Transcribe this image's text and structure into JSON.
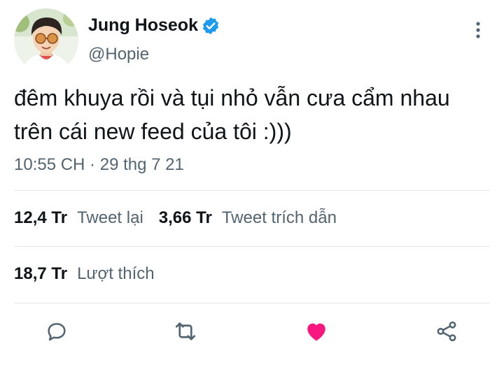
{
  "tweet": {
    "author_name": "Jung Hoseok",
    "handle": "@Hopie",
    "text_line1": "đêm khuya rồi và tụi nhỏ vẫn cưa cẩm nhau",
    "text_line2": "trên cái new feed của tôi :)))",
    "timestamp": "10:55 CH · 29 thg 7 21"
  },
  "stats": {
    "retweets_count": "12,4 Tr",
    "retweets_label": "Tweet lại",
    "quotes_count": "3,66 Tr",
    "quotes_label": "Tweet trích dẫn",
    "likes_count": "18,7 Tr",
    "likes_label": "Lượt thích"
  },
  "icons": {
    "verified": "verified-badge-icon",
    "more": "more-vertical-icon",
    "reply": "reply-icon",
    "retweet": "retweet-icon",
    "like": "heart-icon",
    "share": "share-icon"
  },
  "colors": {
    "verified_blue": "#1d9bf0",
    "like_pink": "#f91880",
    "secondary_text": "#536471",
    "action_gray": "#536471"
  }
}
